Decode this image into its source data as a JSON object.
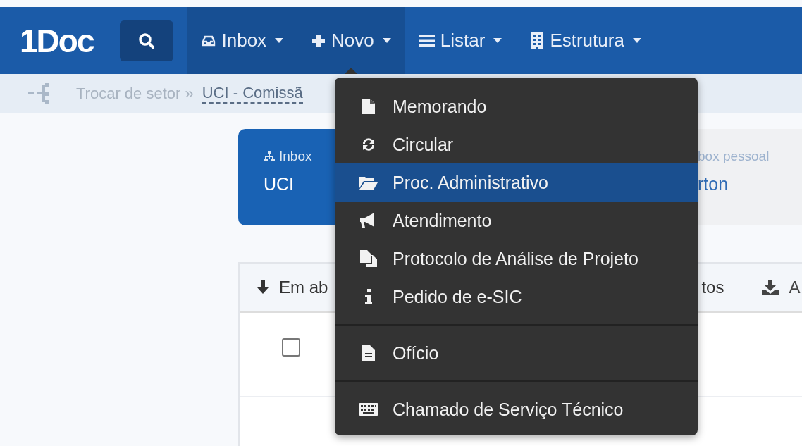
{
  "navbar": {
    "logo": "1Doc",
    "items": [
      {
        "label": "Inbox",
        "selected": true,
        "open": false
      },
      {
        "label": "Novo",
        "selected": true,
        "open": true
      },
      {
        "label": "Listar",
        "selected": false,
        "open": false
      },
      {
        "label": "Estrutura",
        "selected": false,
        "open": false
      }
    ]
  },
  "breadcrumb": {
    "prefix": "Trocar de setor »",
    "link": "UCI - Comissã"
  },
  "cards": [
    {
      "label": "Inbox",
      "value": "UCI",
      "selected": true
    },
    {
      "label": "box pessoal",
      "value": "rton",
      "selected": false
    }
  ],
  "panel": {
    "tabs": [
      {
        "label": "Em ab"
      },
      {
        "label": "tos"
      },
      {
        "label": "A"
      }
    ],
    "rows": [
      {
        "checked": false
      }
    ]
  },
  "dropdown": {
    "items": [
      {
        "label": "Memorando",
        "selected": false,
        "divider_before": false
      },
      {
        "label": "Circular",
        "selected": false,
        "divider_before": false
      },
      {
        "label": "Proc. Administrativo",
        "selected": true,
        "divider_before": false
      },
      {
        "label": "Atendimento",
        "selected": false,
        "divider_before": false
      },
      {
        "label": "Protocolo de Análise de Projeto",
        "selected": false,
        "divider_before": false
      },
      {
        "label": "Pedido de e-SIC",
        "selected": false,
        "divider_before": false
      },
      {
        "label": "Ofício",
        "selected": false,
        "divider_before": true
      },
      {
        "label": "Chamado de Serviço Técnico",
        "selected": false,
        "divider_before": true
      }
    ]
  }
}
